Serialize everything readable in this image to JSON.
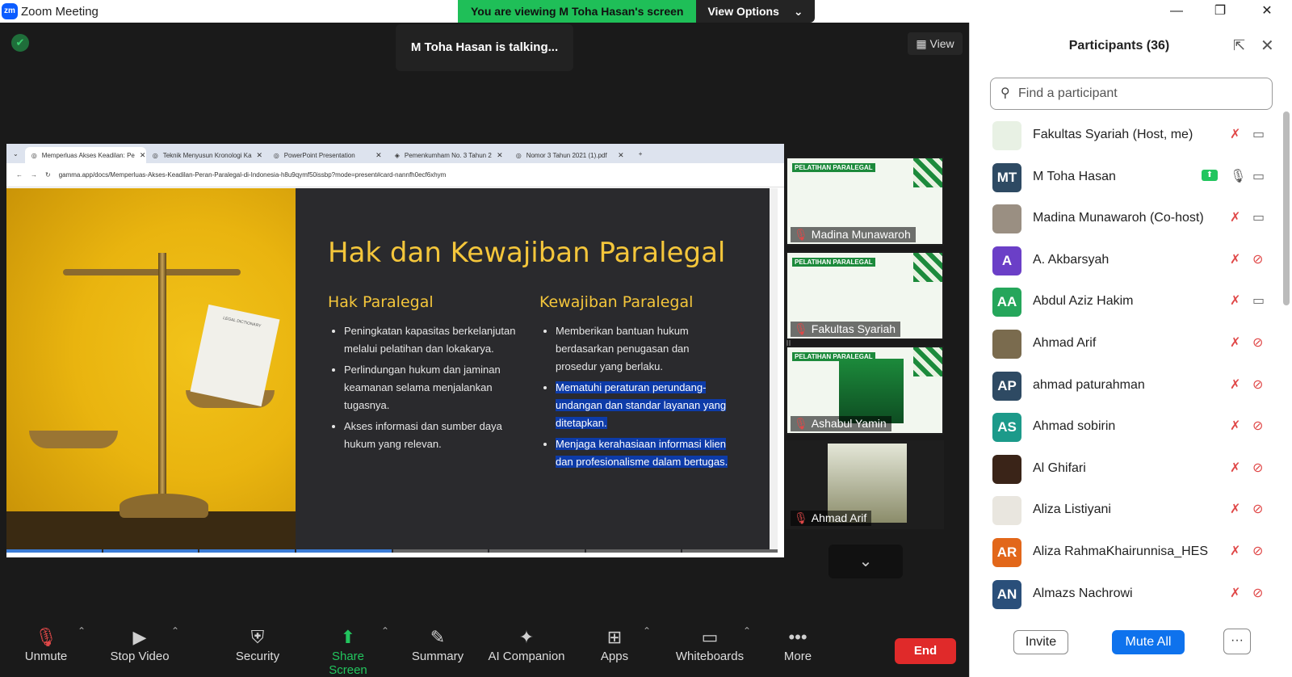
{
  "window": {
    "title": "Zoom Meeting",
    "logo_text": "zm"
  },
  "share_banner": {
    "viewing_text": "You are viewing M Toha Hasan's screen",
    "options_label": "View Options"
  },
  "stage": {
    "talking_text": "M Toha Hasan is talking...",
    "view_label": "View"
  },
  "browser": {
    "tabs": [
      {
        "label": "Memperluas Akses Keadilan: Pe",
        "active": true
      },
      {
        "label": "Teknik Menyusun Kronologi Ka",
        "active": false
      },
      {
        "label": "PowerPoint Presentation",
        "active": false
      },
      {
        "label": "Pemenkumham No. 3 Tahun 2",
        "active": false
      },
      {
        "label": "Nomor 3 Tahun 2021 (1).pdf",
        "active": false
      }
    ],
    "url": "gamma.app/docs/Memperluas-Akses-Keadilan-Peran-Paralegal-di-Indonesia-h8u9qymf50issbp?mode=present#card-nannfh0ecf6xhym"
  },
  "slide": {
    "title": "Hak dan Kewajiban Paralegal",
    "left_heading": "Hak Paralegal",
    "left_items": [
      "Peningkatan kapasitas berkelanjutan melalui pelatihan dan lokakarya.",
      "Perlindungan hukum dan jaminan keamanan selama menjalankan tugasnya.",
      "Akses informasi dan sumber daya hukum yang relevan."
    ],
    "right_heading": "Kewajiban Paralegal",
    "right_items": [
      "Memberikan bantuan hukum berdasarkan penugasan dan prosedur yang berlaku.",
      "Mematuhi peraturan perundang-undangan dan standar layanan yang ditetapkan.",
      "Menjaga kerahasiaan informasi klien dan profesionalisme dalam bertugas."
    ],
    "paper_text": "LEGAL DICTIONARY"
  },
  "thumbnails": [
    {
      "name": "Madina Munawaroh",
      "badge": "PARALEGAL",
      "badge_top": "PELATIHAN"
    },
    {
      "name": "Fakultas Syariah",
      "badge": "PARALEGAL",
      "badge_top": "PELATIHAN"
    },
    {
      "name": "Ashabul Yamin",
      "badge": "PARALEGAL",
      "badge_top": "PELATIHAN"
    },
    {
      "name": "Ahmad Arif"
    }
  ],
  "toolbar": {
    "unmute": "Unmute",
    "stop_video": "Stop Video",
    "security": "Security",
    "share_screen": "Share Screen",
    "summary": "Summary",
    "ai_companion": "AI Companion",
    "apps": "Apps",
    "whiteboards": "Whiteboards",
    "more": "More",
    "end": "End"
  },
  "participants_panel": {
    "title": "Participants (36)",
    "search_placeholder": "Find a participant",
    "invite": "Invite",
    "mute_all": "Mute All",
    "more": "···",
    "participants": [
      {
        "name": "Fakultas Syariah (Host, me)",
        "initials": "",
        "color": "#e8f1e4",
        "mic": "muted",
        "cam": "on"
      },
      {
        "name": "M Toha Hasan",
        "initials": "MT",
        "color": "#2e4a63",
        "mic": "on",
        "cam": "on",
        "sharing": true
      },
      {
        "name": "Madina Munawaroh (Co-host)",
        "initials": "",
        "color": "#9a8f82",
        "mic": "muted",
        "cam": "on"
      },
      {
        "name": "A. Akbarsyah",
        "initials": "A",
        "color": "#6b3fc7",
        "mic": "muted",
        "cam": "off"
      },
      {
        "name": "Abdul Aziz Hakim",
        "initials": "AA",
        "color": "#25a65b",
        "mic": "muted",
        "cam": "on"
      },
      {
        "name": "Ahmad Arif",
        "initials": "",
        "color": "#7a6b4e",
        "mic": "muted",
        "cam": "off"
      },
      {
        "name": "ahmad paturahman",
        "initials": "AP",
        "color": "#2e4a63",
        "mic": "muted",
        "cam": "off"
      },
      {
        "name": "Ahmad sobirin",
        "initials": "AS",
        "color": "#1c9a8a",
        "mic": "muted",
        "cam": "off"
      },
      {
        "name": "Al Ghifari",
        "initials": "",
        "color": "#3a2418",
        "mic": "muted",
        "cam": "off"
      },
      {
        "name": "Aliza Listiyani",
        "initials": "",
        "color": "#e9e6df",
        "mic": "muted",
        "cam": "off"
      },
      {
        "name": "Aliza RahmaKhairunnisa_HES",
        "initials": "AR",
        "color": "#e2671a",
        "mic": "muted",
        "cam": "off"
      },
      {
        "name": "Almazs Nachrowi",
        "initials": "AN",
        "color": "#2a4f7a",
        "mic": "muted",
        "cam": "off"
      }
    ]
  }
}
